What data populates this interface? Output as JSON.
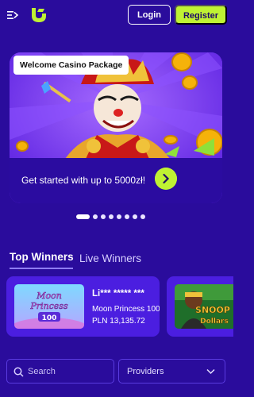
{
  "header": {
    "login_label": "Login",
    "register_label": "Register",
    "menu_icon": "menu-collapse-icon",
    "logo_icon": "brand-logo-icon"
  },
  "hero": {
    "badge": "Welcome Casino Package",
    "cta_text": "Get started with up to 5000zł!",
    "arrow_icon": "chevron-right-icon"
  },
  "carousel": {
    "total_slides": 8,
    "active_index": 0
  },
  "tabs": {
    "top_winners": "Top Winners",
    "live_winners": "Live Winners"
  },
  "winners": [
    {
      "name": "Li*** ***** ***",
      "game": "Moon Princess 100",
      "amount": "PLN 13,135.72",
      "thumb_title_1": "Moon",
      "thumb_title_2": "Princess",
      "thumb_num": "100"
    },
    {
      "thumb_title_1": "SNOOP",
      "thumb_title_2": "Dollars"
    }
  ],
  "filters": {
    "search_placeholder": "Search",
    "providers_label": "Providers"
  },
  "colors": {
    "background": "#2a0c9c",
    "accent_green": "#bff233",
    "card": "#4b1ee0"
  }
}
